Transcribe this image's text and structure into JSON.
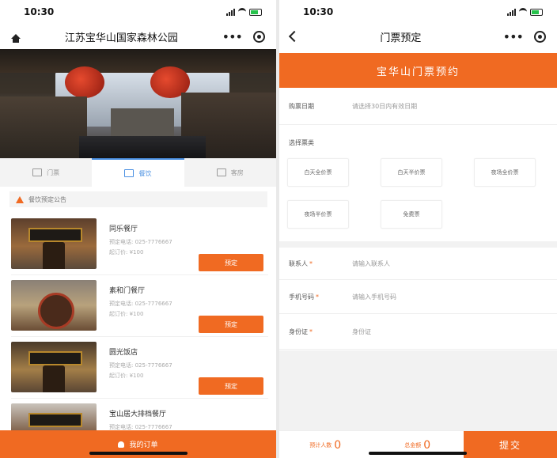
{
  "left": {
    "status_time": "10:30",
    "title": "江苏宝华山国家森林公园",
    "tabs": [
      {
        "label": "门票"
      },
      {
        "label": "餐饮"
      },
      {
        "label": "客房"
      }
    ],
    "notice": "餐饮预定公告",
    "restaurants": [
      {
        "name": "同乐餐厅",
        "phone": "预定电话: 025-7776667",
        "price": "起订价: ¥100",
        "button": "预定"
      },
      {
        "name": "素和门餐厅",
        "phone": "预定电话: 025-7776667",
        "price": "起订价: ¥100",
        "button": "预定"
      },
      {
        "name": "圆光饭店",
        "phone": "预定电话: 025-7776667",
        "price": "起订价: ¥100",
        "button": "预定"
      },
      {
        "name": "宝山居大排档餐厅",
        "phone": "预定电话: 025-7776667"
      }
    ],
    "bottom_bar": "我的订单"
  },
  "right": {
    "status_time": "10:30",
    "title": "门票预定",
    "header": "宝华山门票预约",
    "date_label": "购票日期",
    "date_value": "请选择30日内有效日期",
    "type_label": "选择票类",
    "ticket_types": [
      "白天全价票",
      "白天半价票",
      "夜场全价票",
      "夜场半价票",
      "免费票"
    ],
    "contact_label": "联系人",
    "contact_placeholder": "请输入联系人",
    "phone_label": "手机号码",
    "phone_placeholder": "请输入手机号码",
    "id_label": "身份证",
    "id_placeholder": "身份证",
    "required_mark": "*",
    "count_label": "预计人数",
    "count_value": "0",
    "amount_label": "总金额",
    "amount_value": "0",
    "submit": "提交"
  },
  "colors": {
    "accent": "#f06a22",
    "tab_active": "#4a90e2"
  }
}
